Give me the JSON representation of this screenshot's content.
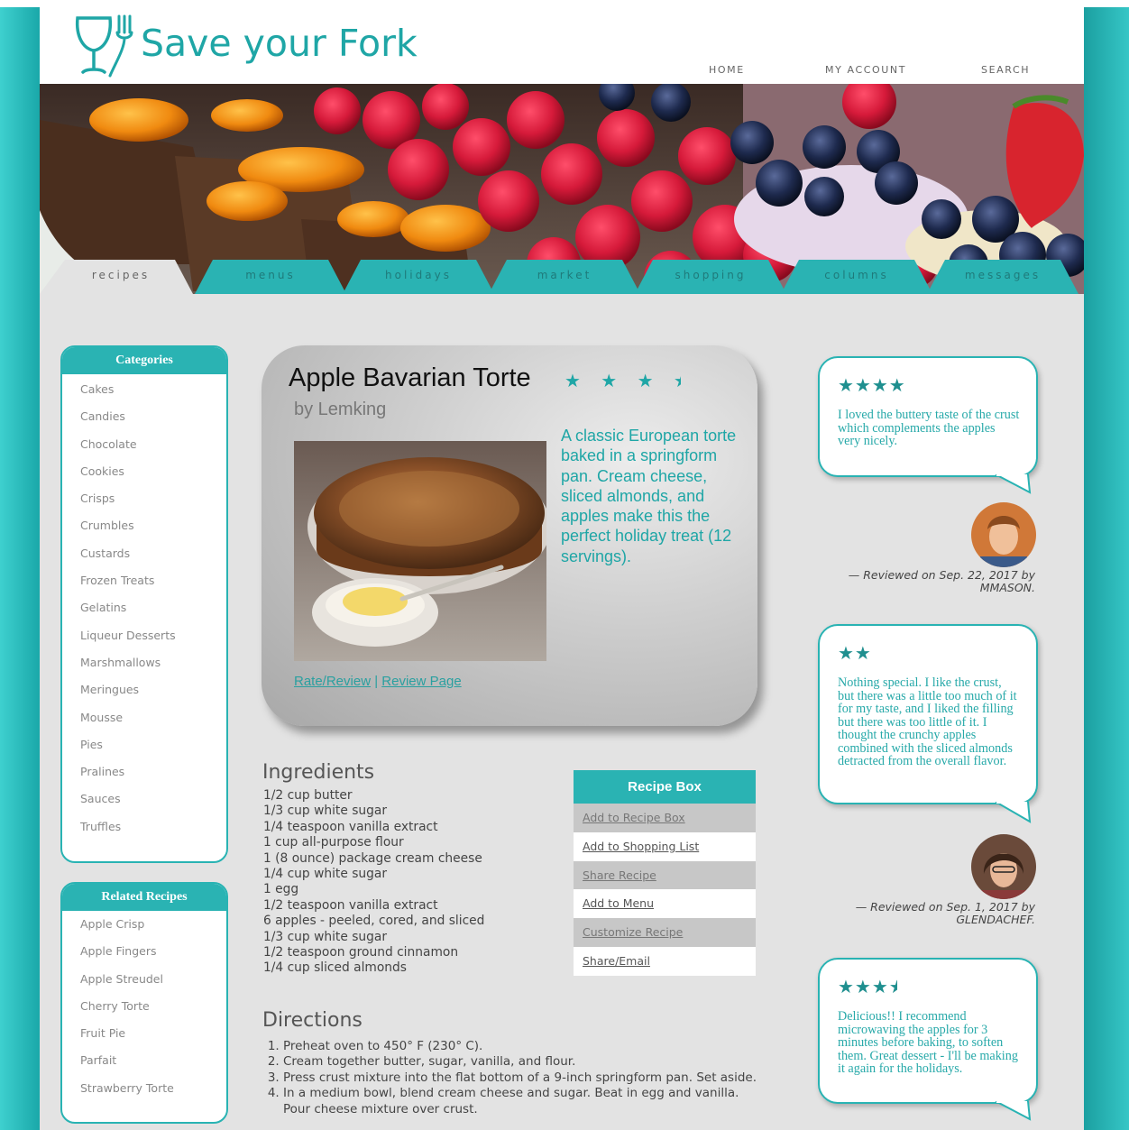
{
  "site": {
    "name": "Save your Fork"
  },
  "topnav": [
    "HOME",
    "MY ACCOUNT",
    "SEARCH"
  ],
  "tabs": [
    "recipes",
    "menus",
    "holidays",
    "market",
    "shopping",
    "columns",
    "messages"
  ],
  "categories": {
    "title": "Categories",
    "items": [
      "Cakes",
      "Candies",
      "Chocolate",
      "Cookies",
      "Crisps",
      "Crumbles",
      "Custards",
      "Frozen Treats",
      "Gelatins",
      "Liqueur Desserts",
      "Marshmallows",
      "Meringues",
      "Mousse",
      "Pies",
      "Pralines",
      "Sauces",
      "Truffles"
    ]
  },
  "related": {
    "title": "Related Recipes",
    "items": [
      "Apple Crisp",
      "Apple Fingers",
      "Apple Streudel",
      "Cherry Torte",
      "Fruit Pie",
      "Parfait",
      "Strawberry Torte"
    ]
  },
  "recipe": {
    "title": "Apple Bavarian Torte",
    "stars": "★ ★ ★ ",
    "half_star": "★",
    "rating": 3.5,
    "byline": "by Lemking",
    "description": "A classic European torte baked in a springform pan. Cream cheese, sliced almonds, and apples make this the perfect holiday treat (12 servings).",
    "link_rate": "Rate/Review",
    "link_sep": " | ",
    "link_review": "Review Page"
  },
  "ingredients": {
    "title": "Ingredients",
    "items": [
      "1/2 cup butter",
      "1/3 cup white sugar",
      "1/4 teaspoon vanilla extract",
      "1 cup all-purpose flour",
      "1 (8 ounce) package cream cheese",
      "1/4 cup white sugar",
      "1 egg",
      "1/2 teaspoon vanilla extract",
      "6 apples - peeled, cored, and sliced",
      "1/3 cup white sugar",
      "1/2 teaspoon ground cinnamon",
      "1/4 cup sliced almonds"
    ]
  },
  "recipe_box": {
    "title": "Recipe Box",
    "items": [
      "Add to Recipe Box",
      "Add to Shopping List",
      "Share Recipe",
      "Add to Menu",
      "Customize Recipe",
      "Share/Email"
    ]
  },
  "directions": {
    "title": "Directions",
    "items": [
      "Preheat oven to 450° F (230° C).",
      "Cream together butter, sugar, vanilla, and flour.",
      "Press crust mixture into the flat bottom of a 9-inch springform pan. Set aside.",
      "In a medium bowl, blend cream cheese and sugar. Beat in egg and vanilla. Pour cheese mixture over crust."
    ]
  },
  "reviews": [
    {
      "stars": "★★★★",
      "rating": 4,
      "text": "I loved the buttery taste of the crust which complements the apples very nicely.",
      "meta": "— Reviewed on Sep. 22, 2017 by MMASON."
    },
    {
      "stars": "★★",
      "rating": 2,
      "text": "Nothing special. I like the crust, but there was a little too much of it for my taste, and I liked the filling but there was too little of it. I thought the crunchy apples combined with the sliced almonds detracted from the overall flavor.",
      "meta": "— Reviewed on Sep. 1, 2017 by GLENDACHEF."
    },
    {
      "stars": "★★★",
      "half_star": "★",
      "rating": 3.5,
      "text": "Delicious!! I recommend microwaving the apples for 3 minutes before baking, to soften them. Great dessert - I'll be making it again for the holidays."
    }
  ],
  "colors": {
    "accent": "#2ab3b3",
    "page_bg": "#e3e3e3"
  }
}
